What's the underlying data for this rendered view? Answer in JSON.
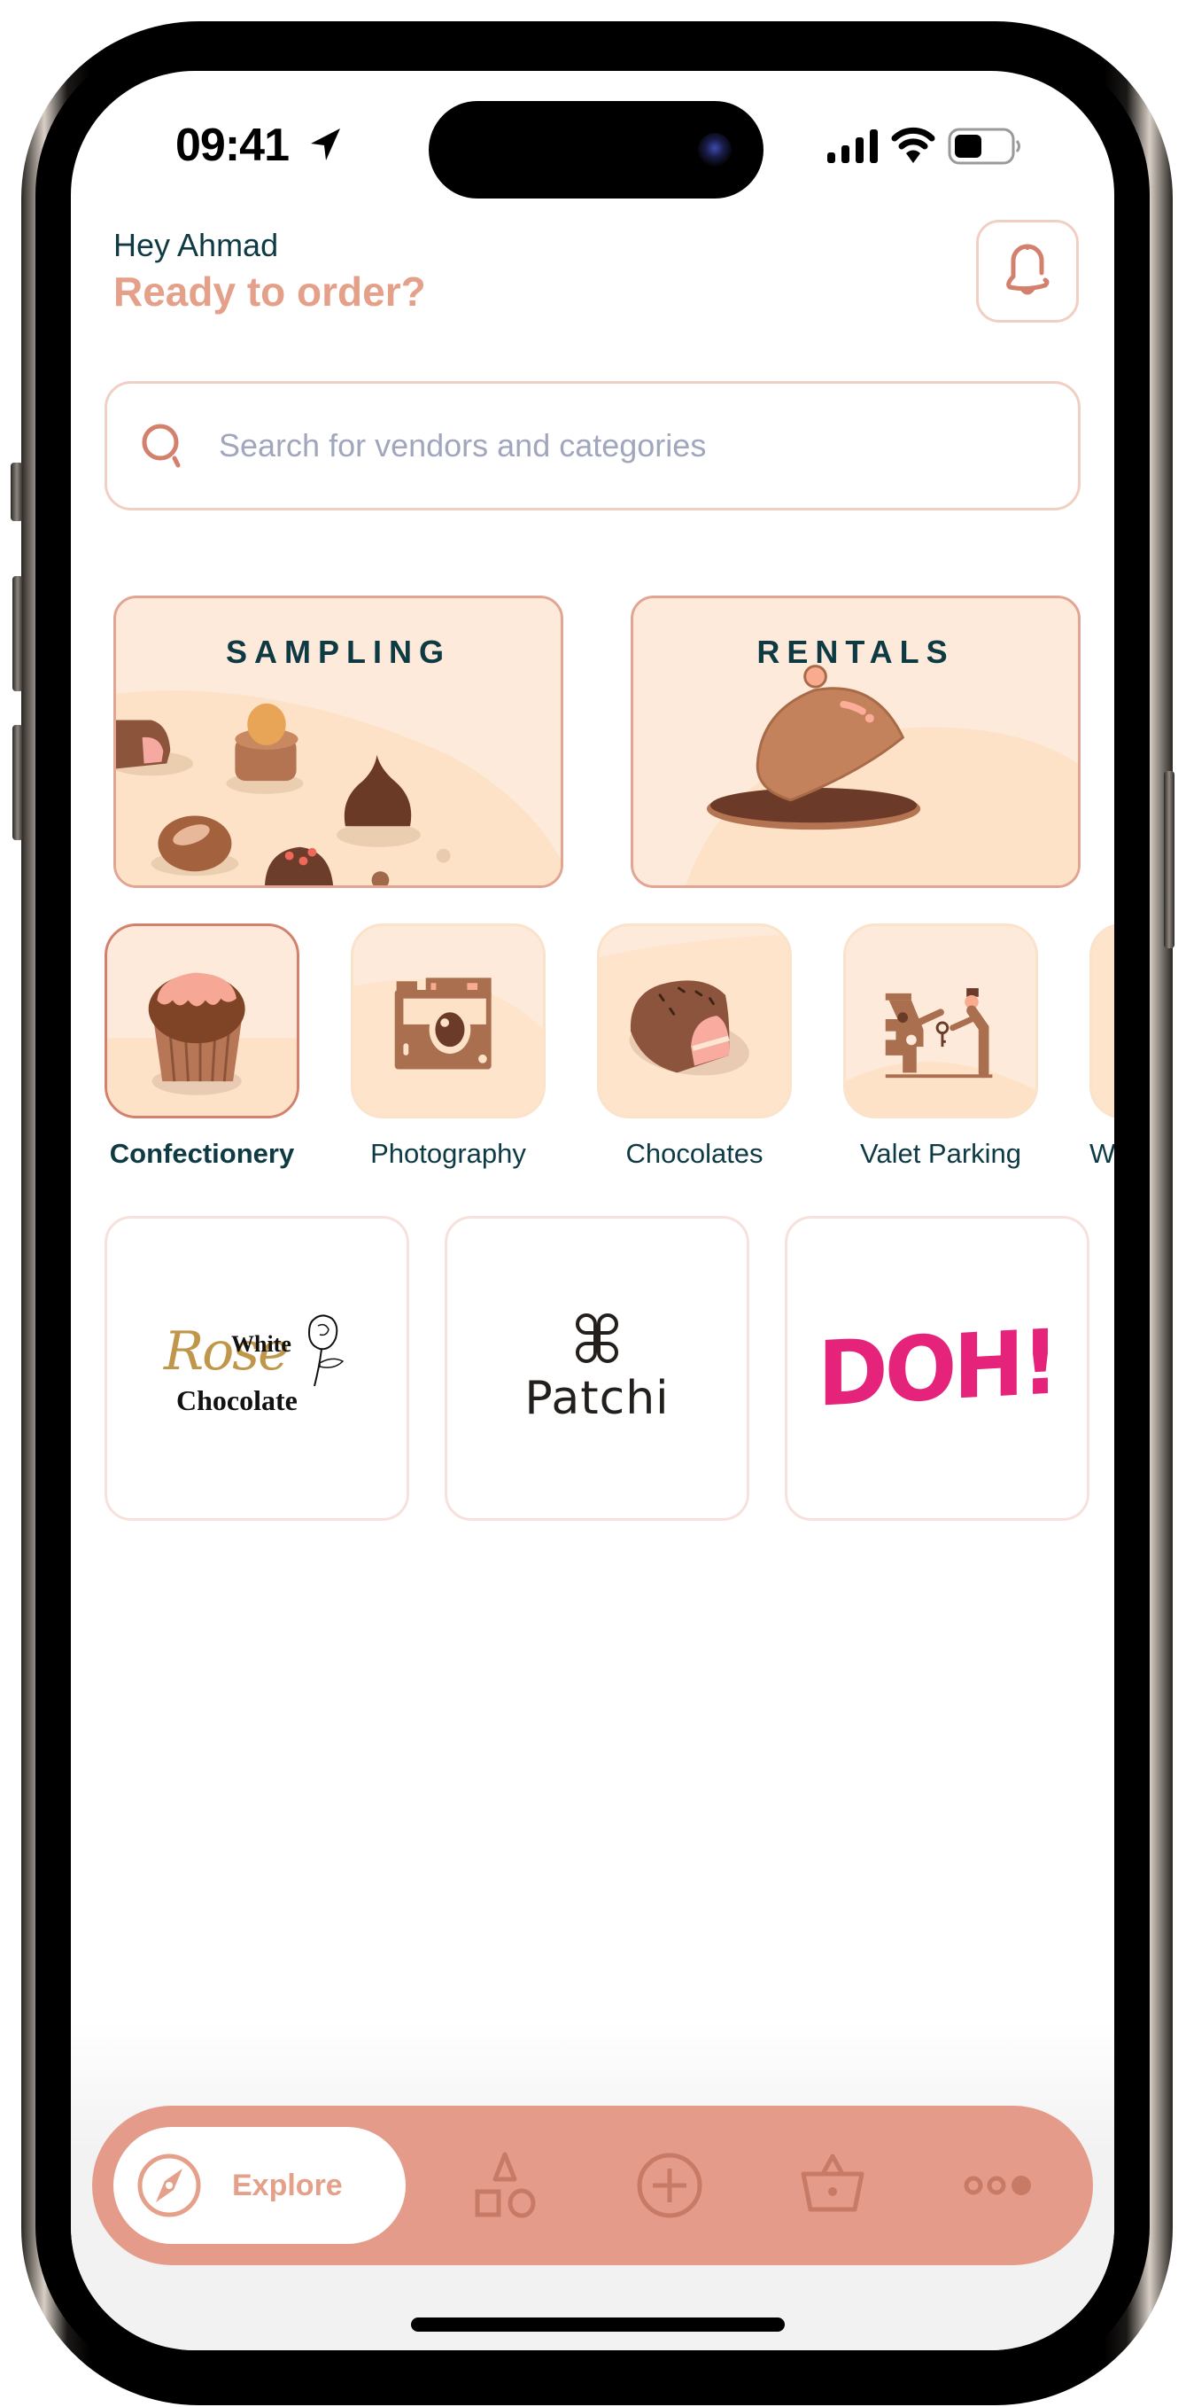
{
  "status_bar": {
    "time": "09:41",
    "icons": [
      "location-arrow-icon",
      "cellular-signal-icon",
      "wifi-icon",
      "battery-icon"
    ]
  },
  "header": {
    "greeting": "Hey Ahmad",
    "headline": "Ready to order?",
    "notification_icon": "bell-icon"
  },
  "search": {
    "placeholder": "Search for vendors and categories",
    "value": "",
    "icon": "search-icon"
  },
  "feature_cards": [
    {
      "title": "SAMPLING",
      "illustration": "chocolates-illustration"
    },
    {
      "title": "RENTALS",
      "illustration": "cloche-illustration"
    }
  ],
  "categories": [
    {
      "label": "Confectionery",
      "icon": "cupcake-icon",
      "selected": true
    },
    {
      "label": "Photography",
      "icon": "camera-icon",
      "selected": false
    },
    {
      "label": "Chocolates",
      "icon": "chocolate-bar-icon",
      "selected": false
    },
    {
      "label": "Valet Parking",
      "icon": "valet-icon",
      "selected": false
    },
    {
      "label": "We",
      "icon": "partial-tile",
      "selected": false
    }
  ],
  "vendors": [
    {
      "name": "White Rose Chocolate",
      "logo_lines": [
        "White",
        "Rose",
        "Chocolate"
      ]
    },
    {
      "name": "Patchi",
      "logo_text": "Patchi"
    },
    {
      "name": "DOH!",
      "logo_text": "DOH!"
    }
  ],
  "tab_bar": {
    "active": {
      "label": "Explore",
      "icon": "compass-icon"
    },
    "tabs": [
      {
        "name": "categories",
        "icon": "shapes-icon"
      },
      {
        "name": "add",
        "icon": "plus-circle-icon"
      },
      {
        "name": "basket",
        "icon": "basket-icon"
      },
      {
        "name": "more",
        "icon": "more-dots-icon"
      }
    ]
  },
  "colors": {
    "accent": "#e5a08a",
    "accent_dark": "#d3806d",
    "tab_bar": "#e49b89",
    "tab_icon": "#c77a66",
    "text_dark": "#0e3a44",
    "placeholder": "#a0a7bd",
    "tile_bg": "#fde4cb",
    "card_border": "#f1cfc3",
    "doh_pink": "#e5237b",
    "gold": "#c0974a"
  }
}
